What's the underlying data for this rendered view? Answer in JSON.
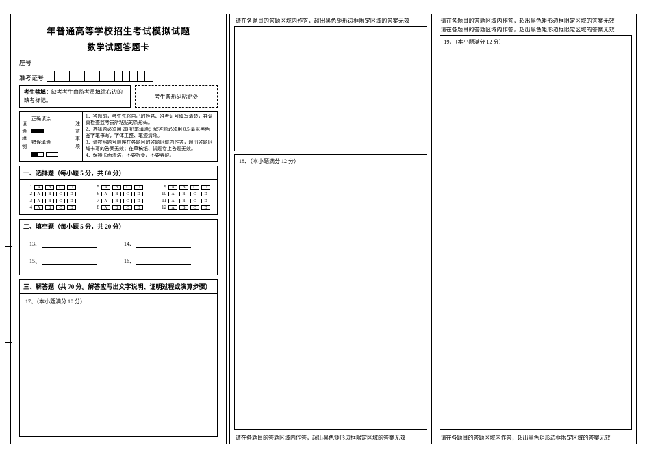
{
  "header": {
    "title_line1": "年普通高等学校招生考试模拟试题",
    "title_line2": "数学试题答题卡"
  },
  "id_section": {
    "seat_label": "座号",
    "exam_no_label": "准考证号",
    "exam_no_cells": 14
  },
  "notice_box": {
    "label_prefix": "考生禁填：",
    "text": "缺考考生由监考员填涂右边的缺考标记。"
  },
  "barcode_box": "考生条形码粘贴处",
  "fill_examples": {
    "vlabel": "填涂样例",
    "correct_label": "正确填涂",
    "wrong_label": "错误填涂"
  },
  "attention": {
    "vlabel": "注意事项",
    "lines": [
      "1．答题前，考生先将自己的姓名、准考证号填写清楚，并认真检查监考员所粘贴的条形码。",
      "2．选择题必须用 2B 铅笔填涂；解答题必须用 0.5 毫米黑色签字笔书写，字体工整、笔迹清晰。",
      "3．请按照题号顺序在各题目的答题区域内作答，超出答题区域书写的答案无效；在草稿纸、试题卷上答题无效。",
      "4．保持卡面清洁，不要折叠、不要弄破。"
    ]
  },
  "sections": {
    "mcq_title": "一、选择题（每小题 5 分，共 60 分）",
    "fill_title": "二、填空题（每小题 5 分，共 20 分）",
    "essay_title": "三、解答题（共 70 分。解答应写出文字说明、证明过程或演算步骤）"
  },
  "mcq": {
    "options": [
      "A",
      "B",
      "C",
      "D"
    ],
    "groups": [
      [
        1,
        2,
        3,
        4
      ],
      [
        5,
        6,
        7,
        8
      ],
      [
        9,
        10,
        11,
        12
      ]
    ]
  },
  "fill_blanks": {
    "items": [
      "13、",
      "14、",
      "15、",
      "16、"
    ]
  },
  "essay": {
    "q17": "17、（本小题满分 10 分）",
    "q18": "18、（本小题满分 12 分）",
    "q19": "19、（本小题满分 12 分）"
  },
  "warning_line": "请在各题目的答题区域内作答，超出黑色矩形边框限定区域的答案无效"
}
